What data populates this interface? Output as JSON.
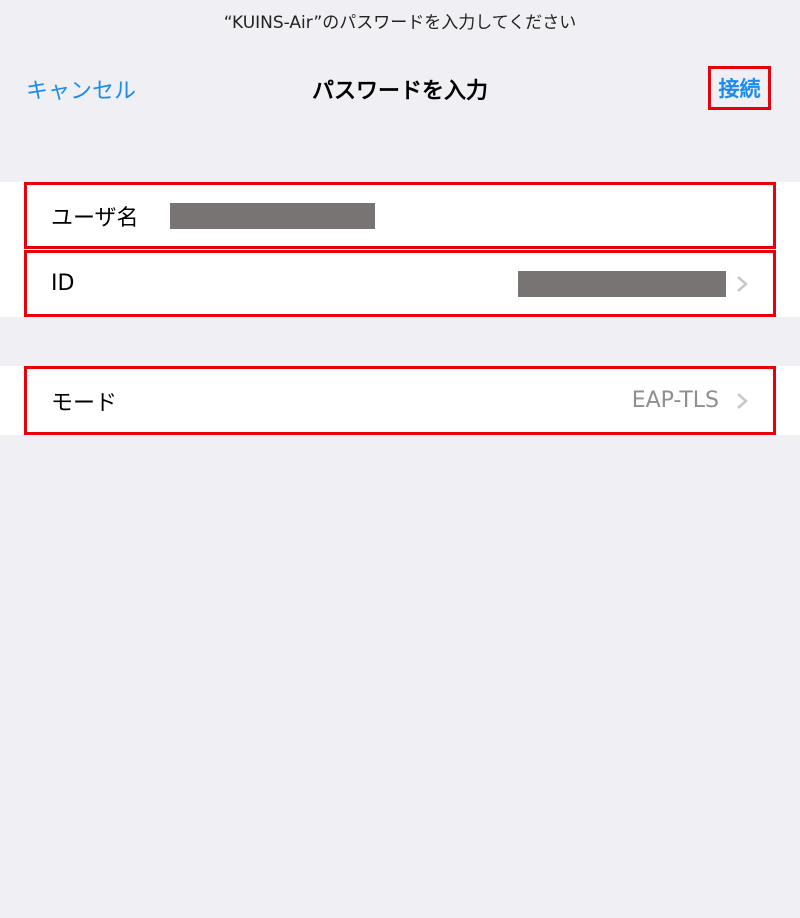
{
  "prompt": "“KUINS-Air”のパスワードを入力してください",
  "nav": {
    "cancel_label": "キャンセル",
    "title": "パスワードを入力",
    "connect_label": "接続"
  },
  "form": {
    "username_label": "ユーザ名",
    "id_label": "ID",
    "mode_label": "モード",
    "mode_value": "EAP-TLS"
  },
  "colors": {
    "accent": "#1a8cf0",
    "highlight_border": "#e8000b",
    "background": "#efeff4",
    "redaction": "#787474"
  },
  "icons": {
    "chevron": "chevron-right-icon"
  }
}
